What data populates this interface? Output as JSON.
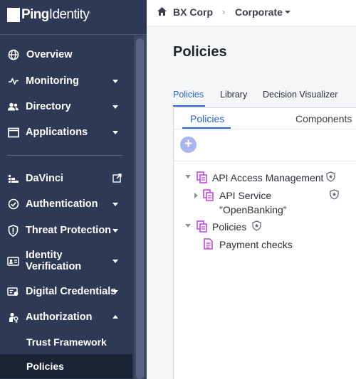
{
  "brand": {
    "logo_bold": "Ping",
    "logo_light": "Identity",
    "logo_tm": "."
  },
  "colors": {
    "sidebar_bg": "#2e3a55",
    "sidebar_active_bg": "#1b2437",
    "accent": "#2b5fd9",
    "policy_icon": "#c23ddb",
    "add_button": "#a9b5ee"
  },
  "sidebar": {
    "items": [
      {
        "label": "Overview",
        "icon": "globe-icon",
        "has_caret": false
      },
      {
        "label": "Monitoring",
        "icon": "pulse-icon",
        "has_caret": true
      },
      {
        "label": "Directory",
        "icon": "users-icon",
        "has_caret": true
      },
      {
        "label": "Applications",
        "icon": "window-icon",
        "has_caret": true
      },
      {
        "label": "DaVinci",
        "icon": "davinci-icon",
        "has_external": true
      },
      {
        "label": "Authentication",
        "icon": "check-circle-icon",
        "has_caret": true
      },
      {
        "label": "Threat Protection",
        "icon": "shield-icon",
        "has_caret": true
      },
      {
        "label": "Identity\nVerification",
        "label_line1": "Identity",
        "label_line2": "Verification",
        "icon": "id-card-icon",
        "has_caret": true
      },
      {
        "label": "Digital Credentials",
        "icon": "credential-icon",
        "has_caret": true
      },
      {
        "label": "Authorization",
        "icon": "authorization-icon",
        "has_caret": true,
        "expanded": true
      }
    ],
    "sub_items": [
      {
        "label": "Trust Framework",
        "active": false
      },
      {
        "label": "Policies",
        "active": true
      }
    ]
  },
  "breadcrumb": {
    "org": "BX Corp",
    "separator": "›",
    "environment": "Corporate"
  },
  "page": {
    "title": "Policies"
  },
  "tabs": [
    {
      "label": "Policies",
      "active": true
    },
    {
      "label": "Library",
      "active": false
    },
    {
      "label": "Decision Visualizer",
      "active": false
    }
  ],
  "subtabs": [
    {
      "label": "Policies",
      "active": true
    },
    {
      "label": "Components",
      "active": false
    }
  ],
  "add_button": {
    "symbol": "+"
  },
  "tree": [
    {
      "label": "API Access Management",
      "expanded": true,
      "level": 0
    },
    {
      "label_line1": "API Service",
      "label_line2": "\"OpenBanking\"",
      "expanded": false,
      "level": 1
    },
    {
      "label": "Policies",
      "expanded": true,
      "level": 0
    },
    {
      "label": "Payment checks",
      "level": 1,
      "leaf": true
    }
  ]
}
